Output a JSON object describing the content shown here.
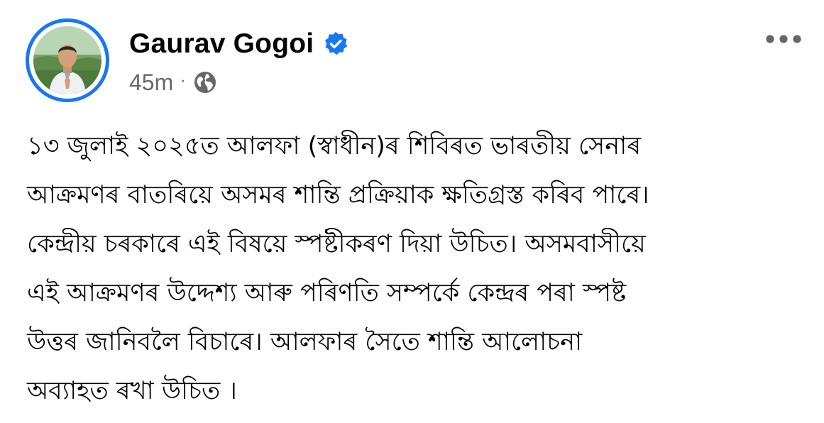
{
  "post": {
    "author": {
      "name": "Gaurav Gogoi",
      "verified": true,
      "verified_icon": "verified-badge-icon",
      "avatar_ring_color": "#1877f2"
    },
    "meta": {
      "time": "45m",
      "separator": "·",
      "audience_icon": "globe-icon"
    },
    "more_icon": "more-horizontal-icon",
    "text_lines": [
      "১৩ জুলাই ২০২৫ত আলফা (স্বাধীন)ৰ শিবিৰত ভাৰতীয় সেনাৰ",
      "আক্রমণৰ বাতৰিয়ে অসমৰ শান্তি প্ৰক্ৰিয়াক ক্ষতিগ্ৰস্ত কৰিব পাৰে।",
      "কেন্দ্ৰীয় চৰকাৰে এই বিষয়ে স্পষ্টীকৰণ দিয়া উচিত। অসমবাসীয়ে",
      "এই আক্ৰমণৰ উদ্দেশ্য আৰু পৰিণতি সম্পৰ্কে কেন্দ্ৰৰ পৰা স্পষ্ট",
      "উত্তৰ জানিবলৈ বিচাৰে। আলফাৰ সৈতে শান্তি আলোচনা",
      "অব্যাহত ৰখা উচিত ।"
    ]
  },
  "colors": {
    "text": "#050505",
    "meta": "#65676b",
    "accent": "#1877f2",
    "background": "#ffffff"
  }
}
